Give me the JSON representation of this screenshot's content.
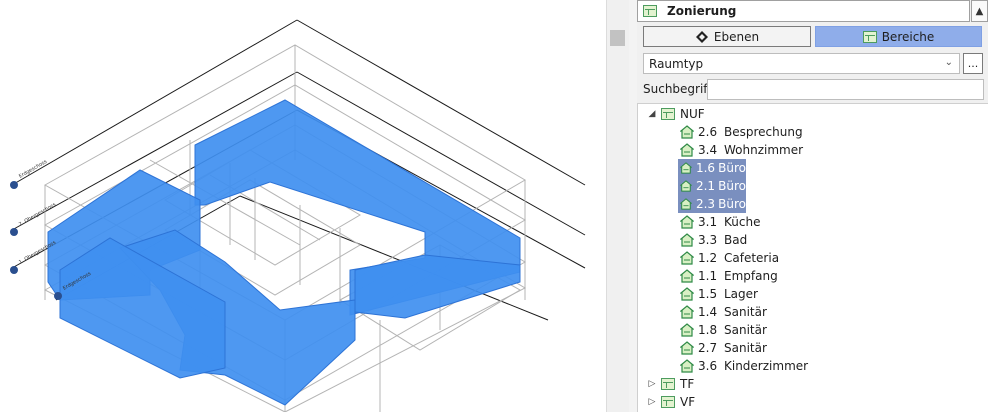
{
  "panel": {
    "title": "Zonierung",
    "btn_ebenen": "Ebenen",
    "btn_bereiche": "Bereiche",
    "dropdown_value": "Raumtyp",
    "more_label": "...",
    "search_label": "Suchbegriff",
    "search_value": ""
  },
  "tree": {
    "groups": [
      {
        "label": "NUF",
        "expanded": true,
        "items": [
          {
            "num": "2.6",
            "name": "Besprechung",
            "selected": false
          },
          {
            "num": "3.4",
            "name": "Wohnzimmer",
            "selected": false
          },
          {
            "num": "1.6",
            "name": "Büro",
            "selected": true
          },
          {
            "num": "2.1",
            "name": "Büro",
            "selected": true
          },
          {
            "num": "2.3",
            "name": "Büro",
            "selected": true
          },
          {
            "num": "3.1",
            "name": "Küche",
            "selected": false
          },
          {
            "num": "3.3",
            "name": "Bad",
            "selected": false
          },
          {
            "num": "1.2",
            "name": "Cafeteria",
            "selected": false
          },
          {
            "num": "1.1",
            "name": "Empfang",
            "selected": false
          },
          {
            "num": "1.5",
            "name": "Lager",
            "selected": false
          },
          {
            "num": "1.4",
            "name": "Sanitär",
            "selected": false
          },
          {
            "num": "1.8",
            "name": "Sanitär",
            "selected": false
          },
          {
            "num": "2.7",
            "name": "Sanitär",
            "selected": false
          },
          {
            "num": "3.6",
            "name": "Kinderzimmer",
            "selected": false
          }
        ]
      },
      {
        "label": "TF",
        "expanded": false,
        "items": []
      },
      {
        "label": "VF",
        "expanded": false,
        "items": []
      }
    ]
  },
  "colors": {
    "zone_fill": "#3f8ff0",
    "selection": "#7a8fbf",
    "active_button": "#8fadea",
    "icon_green": "#4d9c5f"
  },
  "icons": {
    "ebenen": "level-diamond-icon",
    "bereiche": "zone-table-icon",
    "room": "house-icon",
    "group": "zone-table-icon"
  }
}
